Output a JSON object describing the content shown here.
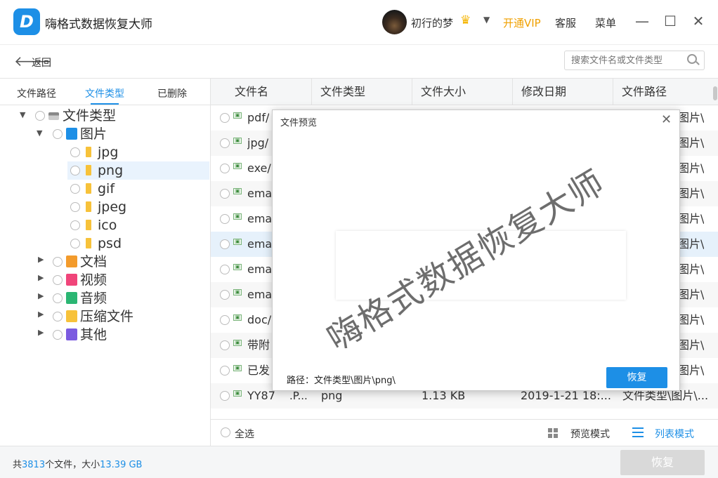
{
  "app": {
    "title": "嗨格式数据恢复大师",
    "logo_letter": "D",
    "user": "初行的梦",
    "vip_link": "开通VIP",
    "service": "客服",
    "menu": "菜单",
    "min_icon": "—",
    "max_icon": "☐",
    "close_icon": "✕"
  },
  "toolbar": {
    "back_label": "返回",
    "search_placeholder": "搜索文件名或文件类型"
  },
  "sidebar": {
    "tabs": [
      "文件路径",
      "文件类型",
      "已删除"
    ],
    "active_tab": "文件类型",
    "tree": [
      {
        "label": "文件类型",
        "icon": "hdd-icon",
        "expanded": true
      },
      {
        "label": "图片",
        "icon": "image-icon",
        "color": "#1d8fe6",
        "expanded": true
      },
      {
        "label": "jpg",
        "icon": "folder-icon"
      },
      {
        "label": "png",
        "icon": "folder-icon",
        "selected": true
      },
      {
        "label": "gif",
        "icon": "folder-icon"
      },
      {
        "label": "jpeg",
        "icon": "folder-icon"
      },
      {
        "label": "ico",
        "icon": "folder-icon"
      },
      {
        "label": "psd",
        "icon": "folder-icon"
      },
      {
        "label": "文档",
        "icon": "document-icon",
        "color": "#f39b2c"
      },
      {
        "label": "视频",
        "icon": "video-icon",
        "color": "#f0457a"
      },
      {
        "label": "音频",
        "icon": "audio-icon",
        "color": "#2bb673"
      },
      {
        "label": "压缩文件",
        "icon": "zip-icon",
        "color": "#f7c23a"
      },
      {
        "label": "其他",
        "icon": "other-icon",
        "color": "#7b5be0"
      }
    ]
  },
  "filelist": {
    "columns": [
      "文件名",
      "文件类型",
      "文件大小",
      "修改日期",
      "文件路径"
    ],
    "rows": [
      {
        "name": "pdf/",
        "type": "",
        "size": "",
        "date": "",
        "path": "图片\\"
      },
      {
        "name": "jpg/",
        "type": "",
        "size": "",
        "date": "",
        "path": "图片\\"
      },
      {
        "name": "exe/",
        "type": "",
        "size": "",
        "date": "",
        "path": "图片\\"
      },
      {
        "name": "ema",
        "type": "",
        "size": "",
        "date": "",
        "path": "图片\\"
      },
      {
        "name": "ema",
        "type": "",
        "size": "",
        "date": "",
        "path": "图片\\"
      },
      {
        "name": "ema",
        "type": "",
        "size": "",
        "date": "",
        "path": "图片\\"
      },
      {
        "name": "ema",
        "type": "",
        "size": "",
        "date": "",
        "path": "图片\\"
      },
      {
        "name": "ema",
        "type": "",
        "size": "",
        "date": "",
        "path": "图片\\"
      },
      {
        "name": "doc/",
        "type": "",
        "size": "",
        "date": "",
        "path": "图片\\"
      },
      {
        "name": "带附",
        "type": "",
        "size": "",
        "date": "",
        "path": "图片\\"
      },
      {
        "name": "已发",
        "type": "",
        "size": "",
        "date": "",
        "path": "图片\\"
      },
      {
        "name": "YY87",
        "ext": ".P...",
        "type": "png",
        "size": "1.13 KB",
        "date": "2019-1-21 18:...",
        "path": "文件类型\\图片\\..."
      }
    ],
    "select_all": "全选",
    "preview_mode": "预览模式",
    "list_mode": "列表模式"
  },
  "status": {
    "prefix": "共",
    "file_count": "3813",
    "mid": "个文件，大小",
    "total_size": "13.39 GB",
    "recover_label": "恢复"
  },
  "dialog": {
    "title": "文件预览",
    "watermark": "嗨格式数据恢复大师",
    "path_label": "路径：文件类型\\图片\\png\\",
    "recover_label": "恢复",
    "close_icon": "✕"
  },
  "colors": {
    "accent": "#1d8fe6",
    "vip": "#f0a000",
    "selected_row": "#e6f1fb"
  }
}
